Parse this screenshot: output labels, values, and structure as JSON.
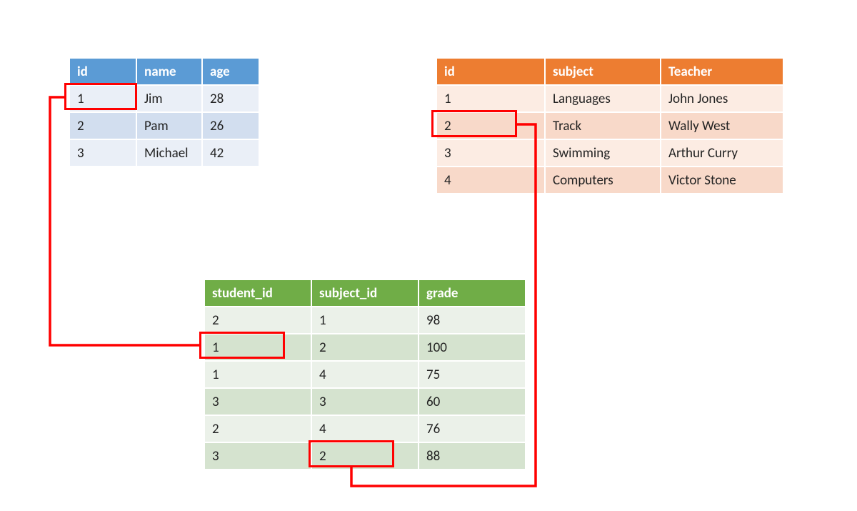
{
  "students_table": {
    "headers": [
      "id",
      "name",
      "age"
    ],
    "rows": [
      {
        "id": "1",
        "name": "Jim",
        "age": "28"
      },
      {
        "id": "2",
        "name": "Pam",
        "age": "26"
      },
      {
        "id": "3",
        "name": "Michael",
        "age": "42"
      }
    ]
  },
  "subjects_table": {
    "headers": [
      "id",
      "subject",
      "Teacher"
    ],
    "rows": [
      {
        "id": "1",
        "subject": "Languages",
        "teacher": "John Jones"
      },
      {
        "id": "2",
        "subject": "Track",
        "teacher": "Wally West"
      },
      {
        "id": "3",
        "subject": "Swimming",
        "teacher": "Arthur Curry"
      },
      {
        "id": "4",
        "subject": "Computers",
        "teacher": "Victor Stone"
      }
    ]
  },
  "grades_table": {
    "headers": [
      "student_id",
      "subject_id",
      "grade"
    ],
    "rows": [
      {
        "student_id": "2",
        "subject_id": "1",
        "grade": "98"
      },
      {
        "student_id": "1",
        "subject_id": "2",
        "grade": "100"
      },
      {
        "student_id": "1",
        "subject_id": "4",
        "grade": "75"
      },
      {
        "student_id": "3",
        "subject_id": "3",
        "grade": "60"
      },
      {
        "student_id": "2",
        "subject_id": "4",
        "grade": "76"
      },
      {
        "student_id": "3",
        "subject_id": "2",
        "grade": "88"
      }
    ]
  },
  "colors": {
    "blue_header": "#5b9bd5",
    "orange_header": "#ed7d31",
    "green_header": "#70ad47",
    "highlight": "#ff0000"
  }
}
